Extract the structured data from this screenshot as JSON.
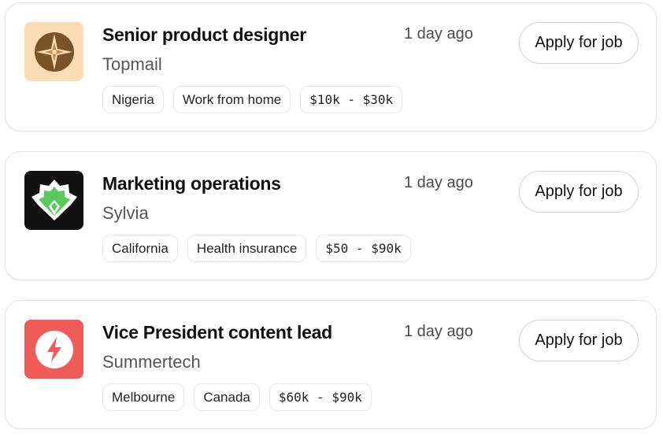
{
  "jobs": [
    {
      "title": "Senior product designer",
      "company": "Topmail",
      "posted": "1 day ago",
      "apply_label": "Apply for job",
      "tags": [
        "Nigeria",
        "Work from home",
        "$10k - $30k"
      ],
      "logo_icon": "compass-star-icon",
      "logo_bg": "#fbdcb4",
      "logo_color": "#7a5428"
    },
    {
      "title": "Marketing operations",
      "company": "Sylvia",
      "posted": "1 day ago",
      "apply_label": "Apply for job",
      "tags": [
        "California",
        "Health insurance",
        "$50 - $90k"
      ],
      "logo_icon": "leaf-emblem-icon",
      "logo_bg": "#111111",
      "logo_color": "#5cc95c"
    },
    {
      "title": "Vice President content lead",
      "company": "Summertech",
      "posted": "1 day ago",
      "apply_label": "Apply for job",
      "tags": [
        "Melbourne",
        "Canada",
        "$60k - $90k"
      ],
      "logo_icon": "lightning-bolt-icon",
      "logo_bg": "#ef5b57",
      "logo_color": "#ffffff"
    }
  ]
}
